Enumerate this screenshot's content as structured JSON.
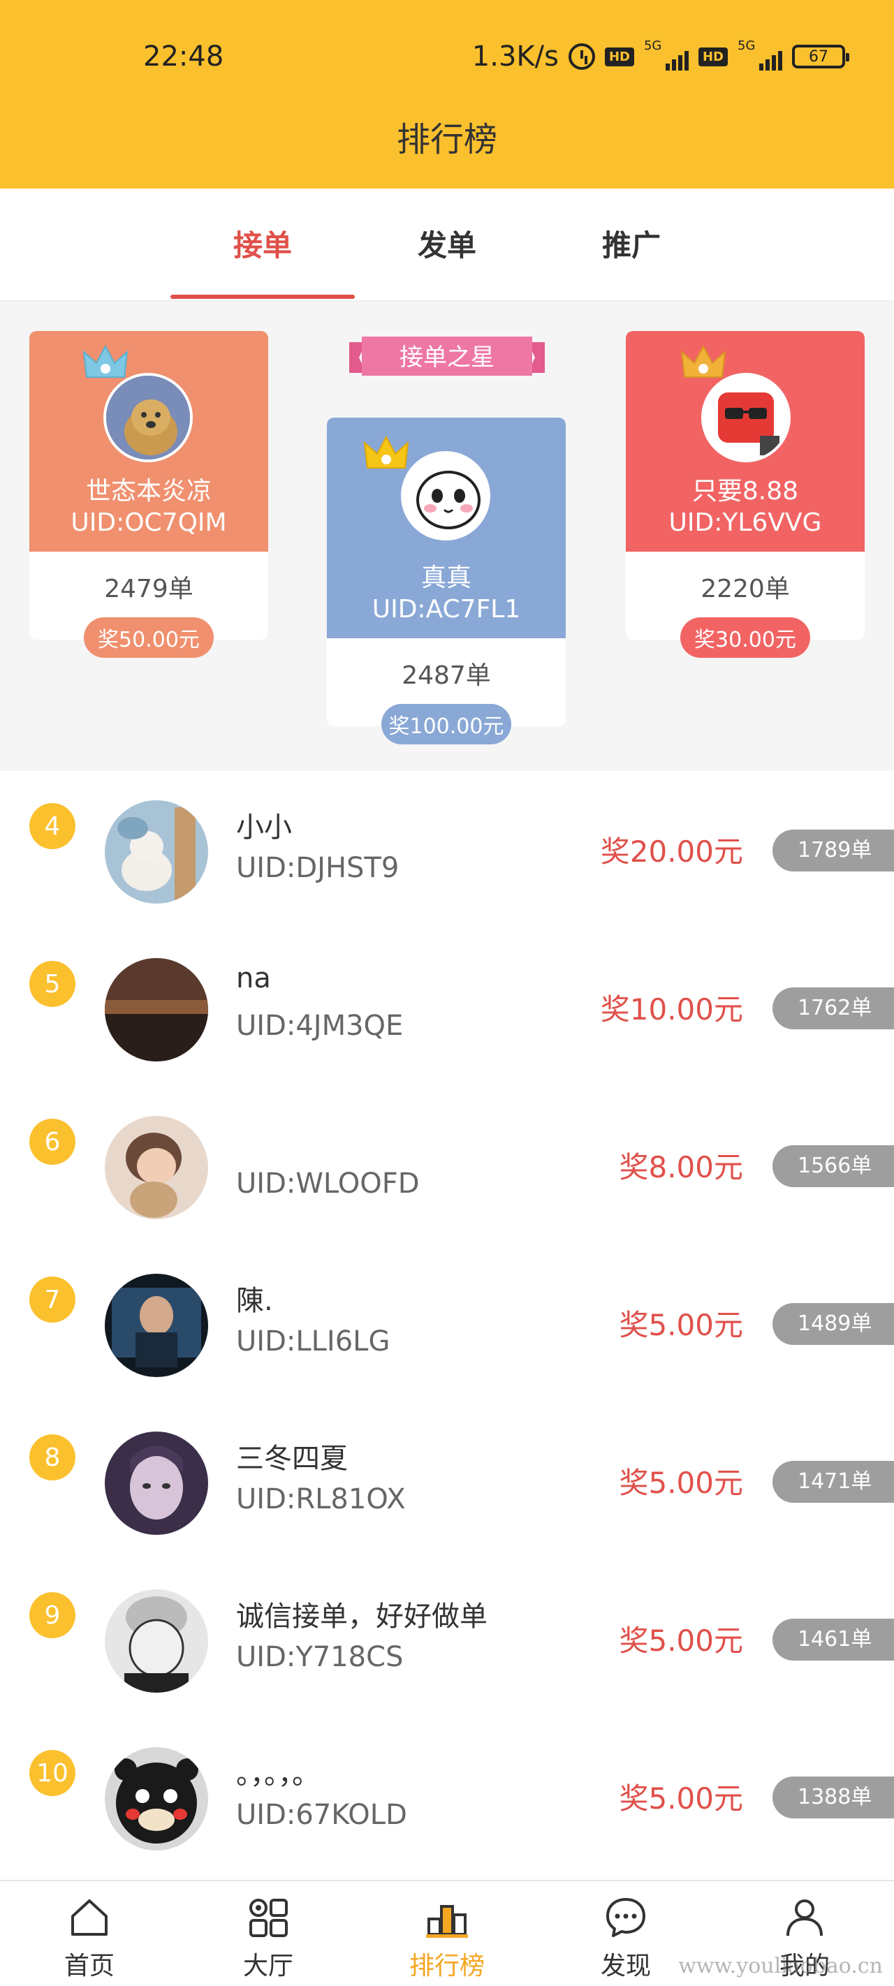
{
  "status_bar": {
    "time": "22:48",
    "net_speed": "1.3K/s",
    "hd1": "HD",
    "g5_1": "5G",
    "hd2": "HD",
    "g5_2": "5G",
    "battery": "67"
  },
  "header": {
    "title": "排行榜"
  },
  "tabs": [
    {
      "label": "接单",
      "active": true
    },
    {
      "label": "发单",
      "active": false
    },
    {
      "label": "推广",
      "active": false
    }
  ],
  "podium": {
    "ribbon": "接单之星",
    "first": {
      "name": "真真",
      "uid": "UID:AC7FL1",
      "count": "2487单",
      "reward": "奖100.00元",
      "color": "#8AA8D6",
      "pill_color": "#8AA8D6"
    },
    "second": {
      "name": "世态本炎凉",
      "uid": "UID:OC7QIM",
      "count": "2479单",
      "reward": "奖50.00元",
      "color": "#F0906E",
      "pill_color": "#F0906E"
    },
    "third": {
      "name": "只要8.88",
      "uid": "UID:YL6VVG",
      "count": "2220单",
      "reward": "奖30.00元",
      "color": "#F26464",
      "pill_color": "#F26464"
    }
  },
  "ranking": [
    {
      "rank": "4",
      "name": "小小",
      "uid": "UID:DJHST9",
      "reward": "奖20.00元",
      "count": "1789单"
    },
    {
      "rank": "5",
      "name": "na",
      "uid": "UID:4JM3QE",
      "reward": "奖10.00元",
      "count": "1762单"
    },
    {
      "rank": "6",
      "name": "",
      "uid": "UID:WLOOFD",
      "reward": "奖8.00元",
      "count": "1566单"
    },
    {
      "rank": "7",
      "name": "陳.",
      "uid": "UID:LLI6LG",
      "reward": "奖5.00元",
      "count": "1489单"
    },
    {
      "rank": "8",
      "name": "三冬四夏",
      "uid": "UID:RL81OX",
      "reward": "奖5.00元",
      "count": "1471单"
    },
    {
      "rank": "9",
      "name": "诚信接单，好好做单",
      "uid": "UID:Y718CS",
      "reward": "奖5.00元",
      "count": "1461单"
    },
    {
      "rank": "10",
      "name": "。，。，。",
      "uid": "UID:67KOLD",
      "reward": "奖5.00元",
      "count": "1388单"
    }
  ],
  "bottom_nav": [
    {
      "label": "首页",
      "icon": "home-icon"
    },
    {
      "label": "大厅",
      "icon": "grid-icon"
    },
    {
      "label": "排行榜",
      "icon": "podium-icon",
      "active": true
    },
    {
      "label": "发现",
      "icon": "chat-icon"
    },
    {
      "label": "我的",
      "icon": "user-icon"
    }
  ],
  "watermark": "www.youliaobao.cn",
  "colors": {
    "header": "#FBC02D",
    "accent": "#E0504A",
    "rank_badge": "#FBC02D",
    "active_nav": "#F5A623"
  }
}
